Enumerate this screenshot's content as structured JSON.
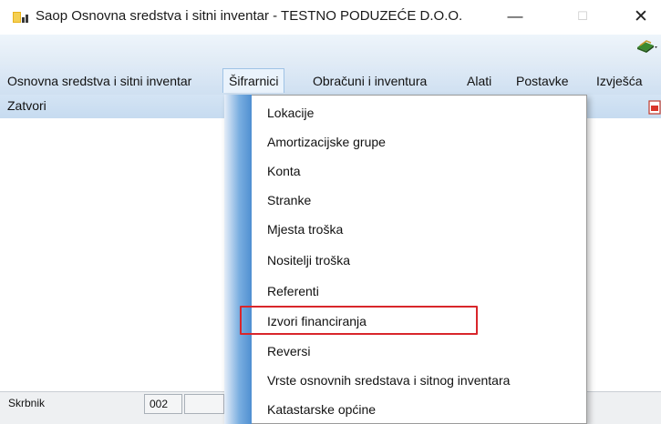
{
  "window": {
    "title": "Saop Osnovna sredstva i sitni inventar - TESTNO PODUZEĆE D.O.O.",
    "minimize": "—",
    "maximize": "☐",
    "close": "✕"
  },
  "menubar": {
    "items": [
      {
        "label": "Osnovna sredstva i sitni inventar"
      },
      {
        "label": "Šifrarnici"
      },
      {
        "label": "Obračuni i inventura"
      },
      {
        "label": "Alati"
      },
      {
        "label": "Postavke"
      },
      {
        "label": "Izvješća"
      }
    ]
  },
  "toolbar": {
    "close_label": "Zatvori"
  },
  "dropdown": {
    "items": [
      {
        "label": "Lokacije"
      },
      {
        "label": "Amortizacijske grupe"
      },
      {
        "label": "Konta"
      },
      {
        "label": "Stranke"
      },
      {
        "label": "Mjesta troška"
      },
      {
        "label": "Nositelji  troška"
      },
      {
        "label": "Referenti"
      },
      {
        "label": "Izvori financiranja"
      },
      {
        "label": "Reversi"
      },
      {
        "label": "Vrste osnovnih sredstava i sitnog inventara"
      },
      {
        "label": "Katastarske općine"
      }
    ],
    "highlighted_index": 7,
    "highlight_color": "#d9262b"
  },
  "statusbar": {
    "label": "Skrbnik",
    "value": "002"
  }
}
